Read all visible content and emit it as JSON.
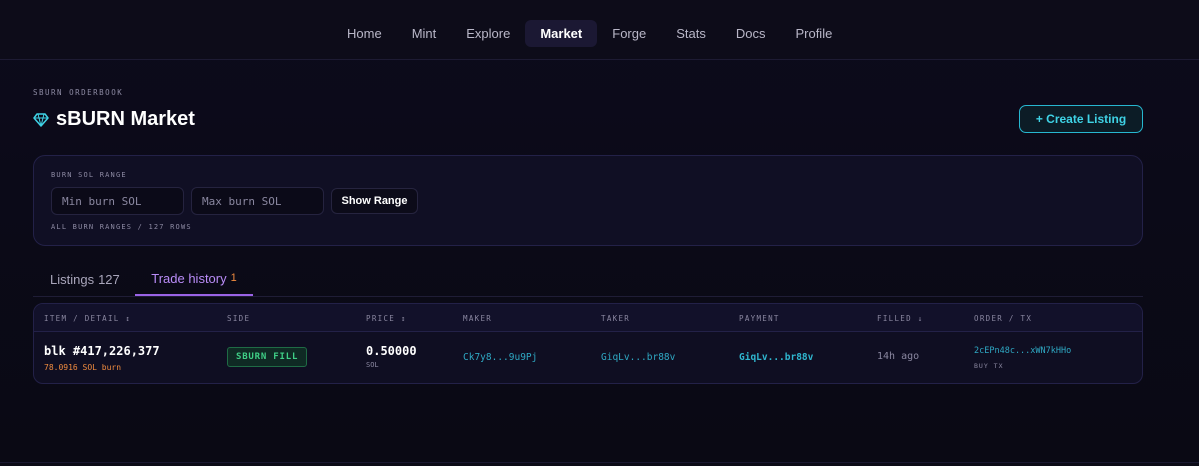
{
  "nav": {
    "items": [
      "Home",
      "Mint",
      "Explore",
      "Market",
      "Forge",
      "Stats",
      "Docs",
      "Profile"
    ],
    "active": "Market"
  },
  "header": {
    "eyebrow": "SBURN ORDERBOOK",
    "title": "sBURN Market",
    "title_icon": "diamond-icon",
    "create_label": "+ Create Listing"
  },
  "range": {
    "label": "BURN SOL RANGE",
    "min_placeholder": "Min burn SOL",
    "max_placeholder": "Max burn SOL",
    "show_label": "Show Range",
    "footer": "ALL BURN RANGES / 127 ROWS"
  },
  "tabs": {
    "listings_label": "Listings",
    "listings_count": "127",
    "history_label": "Trade history",
    "history_count": "1",
    "active": "Trade history"
  },
  "table": {
    "headers": {
      "item": "ITEM / DETAIL ↕",
      "side": "SIDE",
      "price": "PRICE ↕",
      "maker": "MAKER",
      "taker": "TAKER",
      "payment": "PAYMENT",
      "filled": "FILLED ↓",
      "order": "ORDER / TX"
    },
    "rows": [
      {
        "item": "blk #417,226,377",
        "detail": "78.0916 SOL burn",
        "side": "SBURN FILL",
        "price": "0.50000",
        "price_unit": "SOL",
        "maker": "Ck7y8...9u9Pj",
        "taker": "GiqLv...br88v",
        "payment": "GiqLv...br88v",
        "filled": "14h ago",
        "order": "2cEPn48c...xWN7kHHo",
        "order_sub": "BUY TX"
      }
    ]
  },
  "colors": {
    "accent_cyan": "#3fd3e6",
    "accent_purple": "#b98cf7",
    "accent_orange": "#f08b3f",
    "fill_green": "#3fcf86"
  }
}
